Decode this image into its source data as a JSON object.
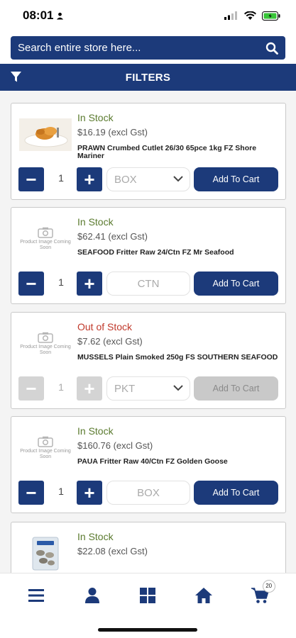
{
  "status_bar": {
    "time": "08:01"
  },
  "search": {
    "placeholder": "Search entire store here..."
  },
  "filters": {
    "label": "FILTERS"
  },
  "products": [
    {
      "stock": "In Stock",
      "price": "$16.19 (excl Gst)",
      "name": "PRAWN Crumbed Cutlet 26/30 65pce 1kg FZ Shore Mariner",
      "qty": "1",
      "unit": "BOX",
      "add_label": "Add To Cart",
      "image": "prawn-photo"
    },
    {
      "stock": "In Stock",
      "price": "$62.41 (excl Gst)",
      "name": "SEAFOOD Fritter Raw 24/Ctn FZ Mr Seafood",
      "qty": "1",
      "unit": "CTN",
      "add_label": "Add To Cart",
      "image_placeholder": "Product Image Coming Soon"
    },
    {
      "stock": "Out of Stock",
      "price": "$7.62 (excl Gst)",
      "name": "MUSSELS Plain Smoked 250g FS SOUTHERN SEAFOOD",
      "qty": "1",
      "unit": "PKT",
      "add_label": "Add To Cart",
      "image_placeholder": "Product Image Coming Soon"
    },
    {
      "stock": "In Stock",
      "price": "$160.76 (excl Gst)",
      "name": "PAUA Fritter Raw 40/Ctn FZ Golden Goose",
      "qty": "1",
      "unit": "BOX",
      "add_label": "Add To Cart",
      "image_placeholder": "Product Image Coming Soon"
    },
    {
      "stock": "In Stock",
      "price": "$22.08 (excl Gst)",
      "image": "mussel-pack-photo"
    }
  ],
  "bottom_nav": {
    "cart_count": "20"
  },
  "colors": {
    "primary": "#1c3a7a",
    "in_stock": "#5a7a2e",
    "out_of_stock": "#c0392b",
    "disabled": "#d4d4d4"
  }
}
